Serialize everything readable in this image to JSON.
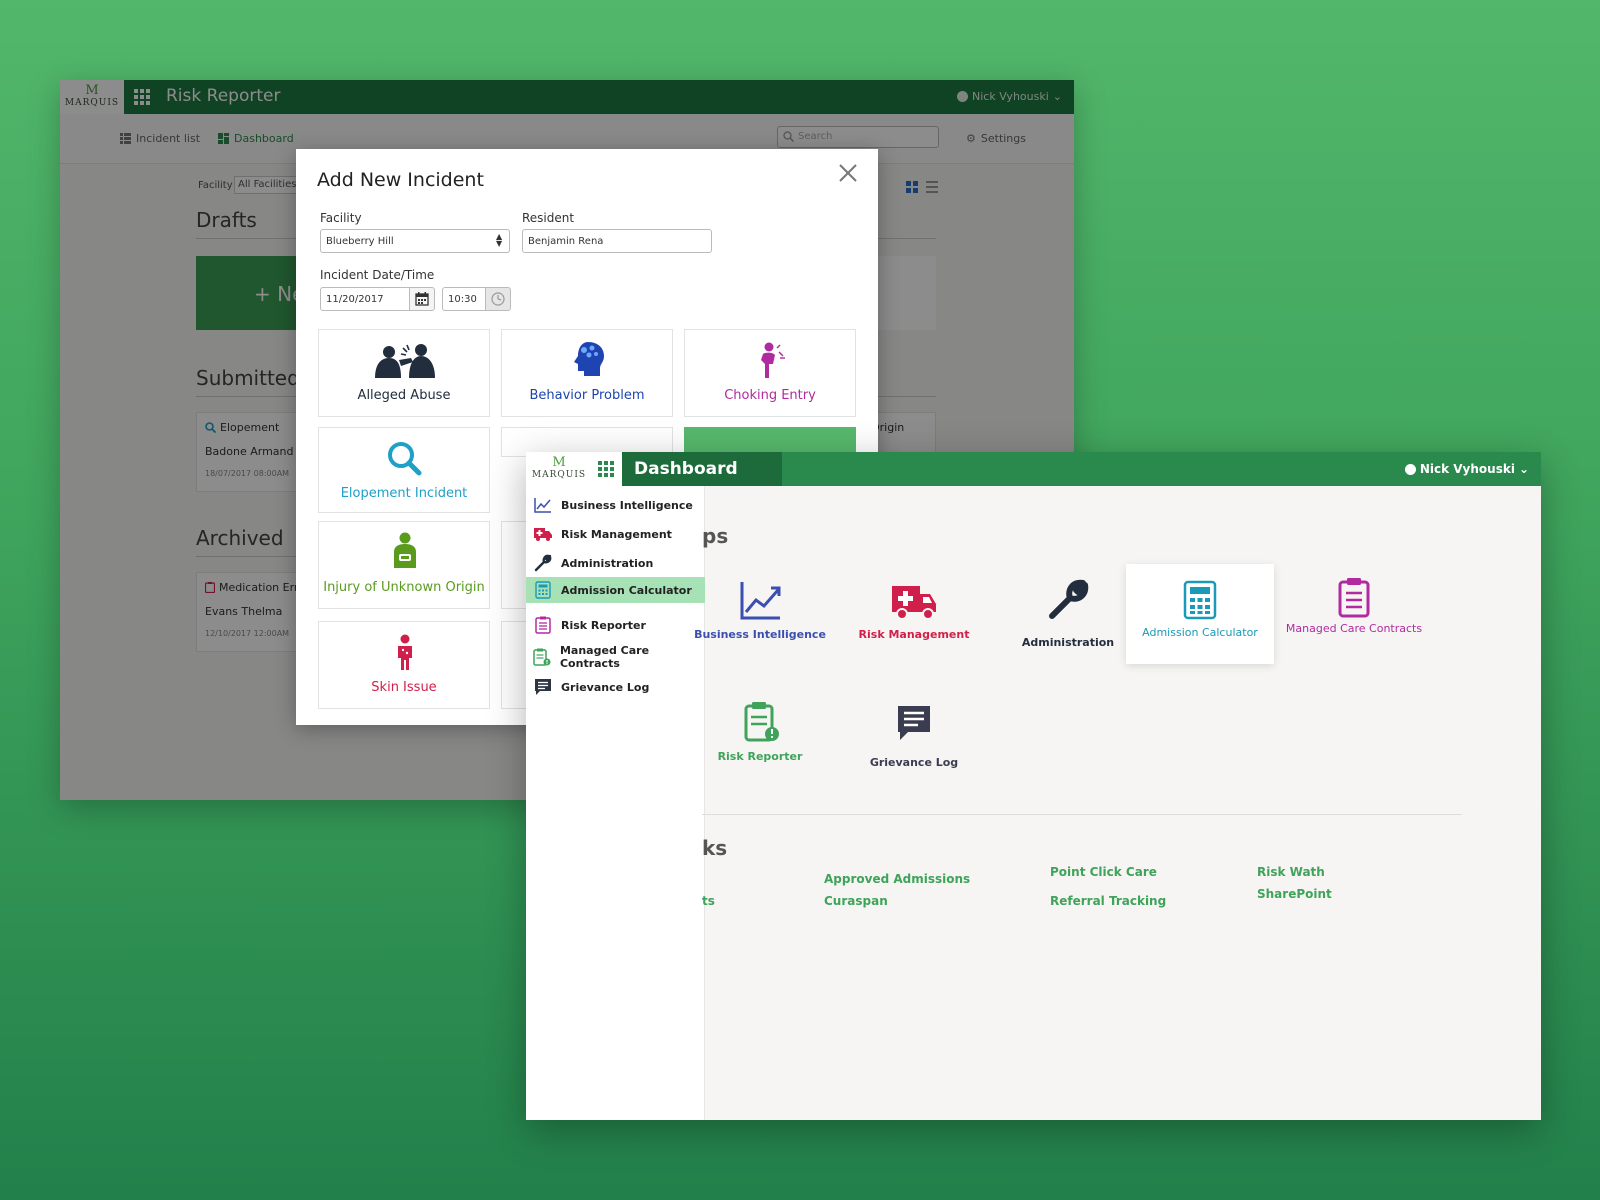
{
  "colors": {
    "brand_green": "#1e7a41",
    "dash_green": "#2a8a4d",
    "accent_green": "#3fa35a",
    "abuse": "#222e3e",
    "behavior": "#1d44b0",
    "choking": "#b02ba0",
    "elopement": "#1ea0c8",
    "injury": "#5a9b1e",
    "skin": "#d01f4a"
  },
  "risk_reporter": {
    "logo_text": "MARQUIS",
    "title": "Risk Reporter",
    "user": "Nick Vyhouski",
    "nav": {
      "incident_list": "Incident list",
      "dashboard": "Dashboard"
    },
    "search_placeholder": "Search",
    "settings": "Settings",
    "filter": {
      "label": "Facility",
      "value": "All Facilities"
    },
    "sections": {
      "drafts": "Drafts",
      "submitted": "Submitted",
      "archived": "Archived"
    },
    "new_card": "+ Ne",
    "submitted_card": {
      "type": "Elopement",
      "name": "Badone Armand",
      "date": "18/07/2017 08:00AM"
    },
    "submitted_card2": {
      "type": "Origin"
    },
    "archived_card": {
      "type": "Medication Erro",
      "name": "Evans Thelma",
      "date": "12/10/2017 12:00AM"
    }
  },
  "modal": {
    "title": "Add New Incident",
    "facility_label": "Facility",
    "facility_value": "Blueberry Hill",
    "resident_label": "Resident",
    "resident_value": "Benjamin Rena",
    "datetime_label": "Incident Date/Time",
    "date_value": "11/20/2017",
    "time_value": "10:30",
    "tiles": {
      "abuse": "Alleged Abuse",
      "behavior": "Behavior Problem",
      "choking": "Choking Entry",
      "elopement": "Elopement Incident",
      "injury": "Injury of Unknown Origin",
      "skin": "Skin Issue"
    }
  },
  "dashboard": {
    "logo_text": "MARQUIS",
    "title": "Dashboard",
    "user": "Nick Vyhouski",
    "sidebar": [
      {
        "label": "Business Intelligence",
        "icon": "chart-line-icon"
      },
      {
        "label": "Risk Management",
        "icon": "ambulance-icon"
      },
      {
        "label": "Administration",
        "icon": "wrench-icon"
      },
      {
        "label": "Admission Calculator",
        "icon": "calculator-icon"
      },
      {
        "label": "Risk Reporter",
        "icon": "clipboard-icon"
      },
      {
        "label": "Managed Care Contracts",
        "icon": "clipboard-alert-icon"
      },
      {
        "label": "Grievance Log",
        "icon": "message-icon"
      }
    ],
    "apps_heading": "ps",
    "apps": {
      "bi": "Business Intelligence",
      "rm": "Risk Management",
      "admin": "Administration",
      "calc": "Admission Calculator",
      "mcc": "Managed Care Contracts",
      "rr": "Risk Reporter",
      "grievance": "Grievance Log"
    },
    "links_heading": "ks",
    "links": {
      "partial": "ts",
      "approved": "Approved Admissions",
      "curaspan": "Curaspan",
      "pcc": "Point Click Care",
      "referral": "Referral Tracking",
      "riskwath": "Risk Wath",
      "sharepoint": "SharePoint"
    }
  }
}
